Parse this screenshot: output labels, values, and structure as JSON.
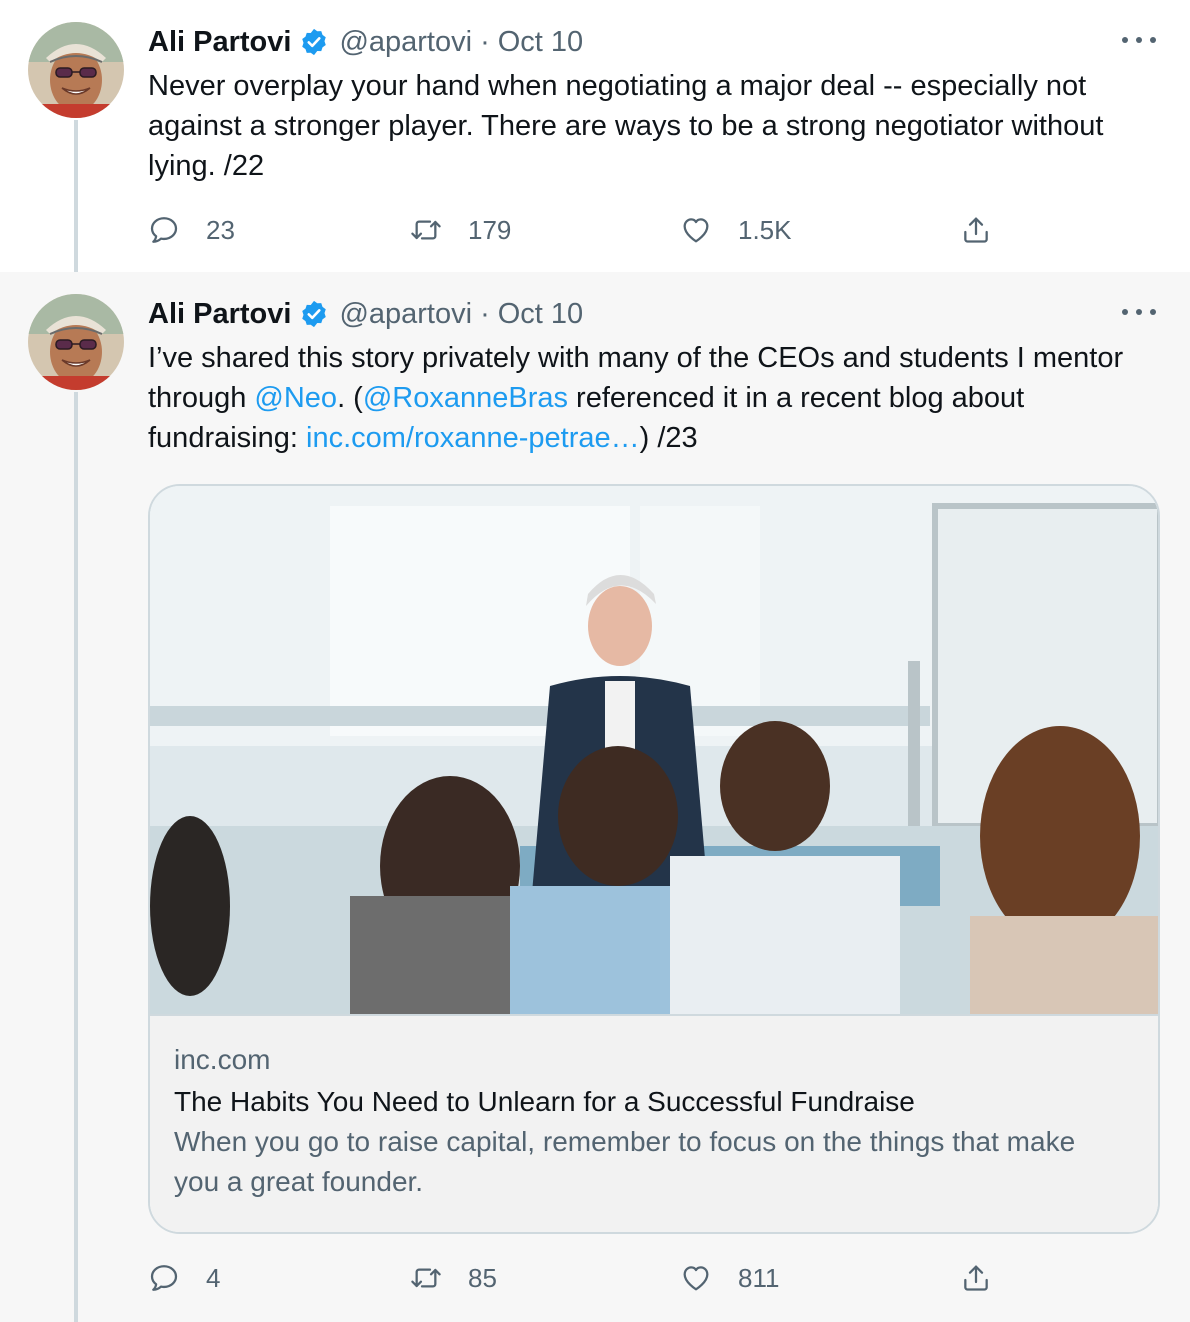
{
  "colors": {
    "link": "#1d9bf0",
    "secondary_text": "#536471",
    "verified": "#1d9bf0",
    "thread_line": "#cfd9de"
  },
  "tweets": [
    {
      "name": "Ali Partovi",
      "handle": "@apartovi",
      "separator": "·",
      "date": "Oct 10",
      "text": "Never overplay your hand when negotiating a major deal -- especially not against a stronger player. There are ways to be a strong negotiator without lying. /22",
      "replies": "23",
      "retweets": "179",
      "likes": "1.5K"
    },
    {
      "name": "Ali Partovi",
      "handle": "@apartovi",
      "separator": "·",
      "date": "Oct 10",
      "text_parts": {
        "p1": "I’ve shared this story privately with many of the CEOs and students I mentor through ",
        "mention1": "@Neo",
        "p2": ". (",
        "mention2": "@RoxanneBras",
        "p3": " referenced it in a recent blog about fundraising: ",
        "url": "inc.com/roxanne-petrae…",
        "p4": ") /23"
      },
      "card": {
        "domain": "inc.com",
        "title": "The Habits You Need to Unlearn for a Successful Fundraise",
        "description": "When you go to raise capital, remember to focus on the things that make you a great founder."
      },
      "replies": "4",
      "retweets": "85",
      "likes": "811"
    }
  ]
}
